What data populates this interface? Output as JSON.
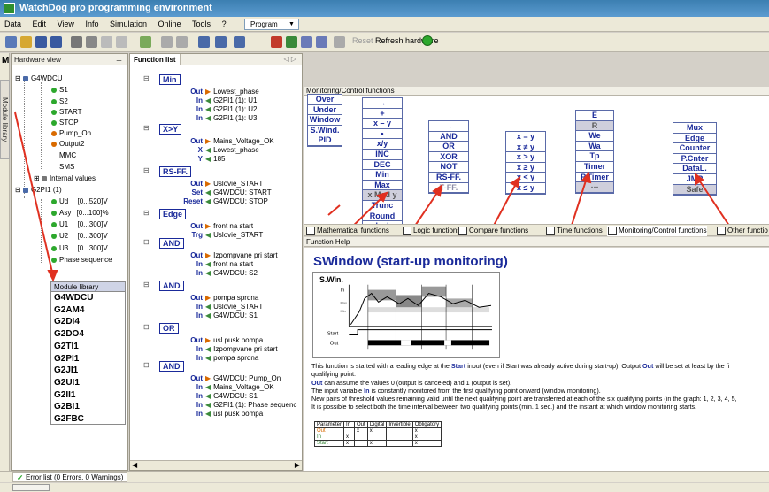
{
  "window": {
    "title": "WatchDog pro programming environment"
  },
  "menu": [
    "Data",
    "Edit",
    "View",
    "Info",
    "Simulation",
    "Online",
    "Tools",
    "?"
  ],
  "mode_select": {
    "value": "Program"
  },
  "toolbar": {
    "reset_label": "Reset",
    "refresh_label": "Refresh hardware"
  },
  "side_tab": {
    "letter": "M",
    "label": "Module library"
  },
  "hardware_view": {
    "title": "Hardware view",
    "root": "G4WDCU",
    "items": [
      "S1",
      "S2",
      "START",
      "STOP",
      "Pump_On",
      "Output2",
      "MMC",
      "SMS",
      "Internal values"
    ],
    "module": "G2PI1 (1)",
    "module_items": [
      {
        "name": "Ud",
        "range": "[0...520]V"
      },
      {
        "name": "Asy",
        "range": "[0...100]%"
      },
      {
        "name": "U1",
        "range": "[0...300]V"
      },
      {
        "name": "U2",
        "range": "[0...300]V"
      },
      {
        "name": "U3",
        "range": "[0...300]V"
      },
      {
        "name": "Phase sequence",
        "range": ""
      }
    ]
  },
  "module_library": {
    "title": "Module library",
    "items": [
      "G4WDCU",
      "G2AM4",
      "G2DI4",
      "G2DO4",
      "G2TI1",
      "G2PI1",
      "G2JI1",
      "G2UI1",
      "G2II1",
      "G2BI1",
      "G2FBC"
    ]
  },
  "function_list": {
    "title": "Function list",
    "blocks": [
      {
        "name": "Min",
        "rows": [
          [
            "Out",
            "Lowest_phase"
          ],
          [
            "In",
            "G2PI1 (1): U1"
          ],
          [
            "In",
            "G2PI1 (1): U2"
          ],
          [
            "In",
            "G2PI1 (1): U3"
          ]
        ]
      },
      {
        "name": "X>Y",
        "rows": [
          [
            "Out",
            "Mains_Voltage_OK"
          ],
          [
            "X",
            "Lowest_phase"
          ],
          [
            "Y",
            "185"
          ]
        ]
      },
      {
        "name": "RS-FF.",
        "rows": [
          [
            "Out",
            "Uslovie_START"
          ],
          [
            "Set",
            "G4WDCU: START"
          ],
          [
            "Reset",
            "G4WDCU: STOP"
          ]
        ]
      },
      {
        "name": "Edge",
        "rows": [
          [
            "Out",
            "front na start"
          ],
          [
            "Trg",
            "Uslovie_START"
          ]
        ]
      },
      {
        "name": "AND",
        "rows": [
          [
            "Out",
            "Izpompvane pri start"
          ],
          [
            "In",
            "front na start"
          ],
          [
            "In",
            "G4WDCU: S2"
          ]
        ]
      },
      {
        "name": "AND",
        "rows": [
          [
            "Out",
            "pompa sprqna"
          ],
          [
            "In",
            "Uslovie_START"
          ],
          [
            "In",
            "G4WDCU: S1"
          ]
        ]
      },
      {
        "name": "OR",
        "rows": [
          [
            "Out",
            "usl pusk pompa"
          ],
          [
            "In",
            "Izpompvane pri start"
          ],
          [
            "In",
            "pompa sprqna"
          ]
        ]
      },
      {
        "name": "AND",
        "rows": [
          [
            "Out",
            "G4WDCU: Pump_On"
          ],
          [
            "In",
            "Mains_Voltage_OK"
          ],
          [
            "In",
            "G4WDCU: S1"
          ],
          [
            "In",
            "G2PI1 (1): Phase sequenc"
          ],
          [
            "In",
            "usl pusk pompa"
          ]
        ]
      }
    ]
  },
  "monitoring": {
    "title": "Monitoring/Control functions",
    "control": [
      "Over",
      "Under",
      "Window",
      "S.Wind.",
      "PID"
    ],
    "math": [
      "→",
      "+",
      "x – y",
      "•",
      "x/y",
      "INC",
      "DEC",
      "Min",
      "Max",
      "x Med y",
      "Trunc",
      "Round",
      "| x |"
    ],
    "logic": [
      "→",
      "AND",
      "OR",
      "XOR",
      "NOT",
      "RS-FF.",
      "T-FF."
    ],
    "compare": [
      "x = y",
      "x ≠ y",
      "x > y",
      "x ≥ y",
      "x < y",
      "x ≤ y"
    ],
    "time": [
      "E",
      "R",
      "We",
      "Wa",
      "Tp",
      "Timer",
      "P.Timer",
      "⋯"
    ],
    "other": [
      "Mux",
      "Edge",
      "Counter",
      "P.Cnter",
      "DataL.",
      "JMP",
      "Safe"
    ]
  },
  "function_tabs": [
    "Mathematical functions",
    "Logic functions",
    "Compare functions",
    "Time functions",
    "Monitoring/Control functions",
    "Other functio"
  ],
  "function_help": {
    "header": "Function Help",
    "title": "SWindow  (start-up monitoring)",
    "diagram_title": "S.Win.",
    "diagram_labels": [
      "In",
      "Max",
      "Min",
      "Start",
      "Out"
    ],
    "p1": "This function is started with a leading edge at the ",
    "p1_start": "Start",
    "p1b": " input (even if Start was already active during start-up). Output ",
    "p1_out": "Out",
    "p1c": " will be set at least by the fi",
    "p1_line2": "qualifying point.",
    "p2_out": "Out",
    "p2": " can assume the values 0 (output is canceled) and 1 (output is set).",
    "p3a": "The input variable ",
    "p3_in": "In",
    "p3b": " is constantly monitored from the first qualifying point onward (window monitoring).",
    "p4": "New pairs of threshold values remaining valid until the next qualifying point are transferred at each of the six qualifying points (in the graph: 1, 2, 3, 4, 5,",
    "p5": "It is possible to select both the time interval between two qualifying points (min. 1 sec.) and the instant at which window monitoring starts.",
    "table_header": [
      "Parameter",
      "In",
      "Out",
      "Digital",
      "Invertible",
      "Obligatory"
    ],
    "table_rows": [
      [
        "Out",
        "",
        "x",
        "x",
        "",
        "x"
      ],
      [
        "In",
        "x",
        "",
        "",
        "",
        "x"
      ],
      [
        "Start",
        "x",
        "",
        "x",
        "",
        "x"
      ]
    ]
  },
  "error_list": {
    "label": "Error list (0 Errors, 0 Warnings)"
  },
  "colors": {
    "accent": "#1a2a9a",
    "arrow": "#e03020",
    "title_bar": "#3c7fb1"
  }
}
